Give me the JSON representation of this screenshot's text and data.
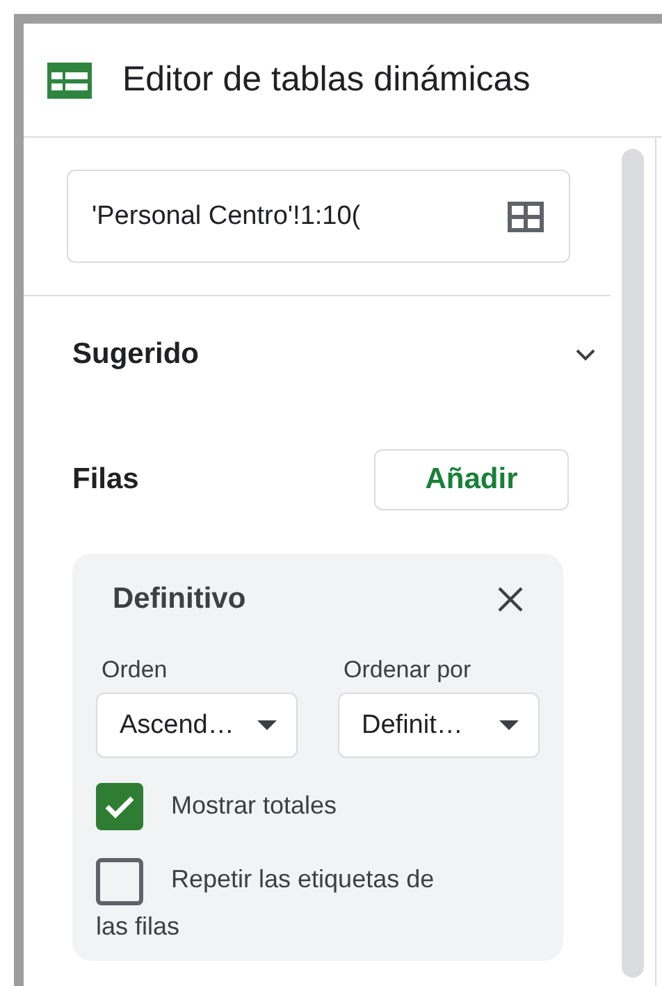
{
  "panel": {
    "title": "Editor de tablas dinámicas"
  },
  "range_field": {
    "value": "'Personal Centro'!1:10("
  },
  "suggested": {
    "label": "Sugerido",
    "expanded": false
  },
  "rows_section": {
    "label": "Filas",
    "add_button": "Añadir"
  },
  "row_card": {
    "title": "Definitivo",
    "selects": [
      {
        "label": "Orden",
        "value": "Ascend…"
      },
      {
        "label": "Ordenar por",
        "value": "Definit…"
      }
    ],
    "options": [
      {
        "label_lines": [
          "Mostrar totales"
        ],
        "checked": true
      },
      {
        "label_lines": [
          "Repetir las etiquetas de",
          "las filas"
        ],
        "checked": false
      }
    ]
  }
}
